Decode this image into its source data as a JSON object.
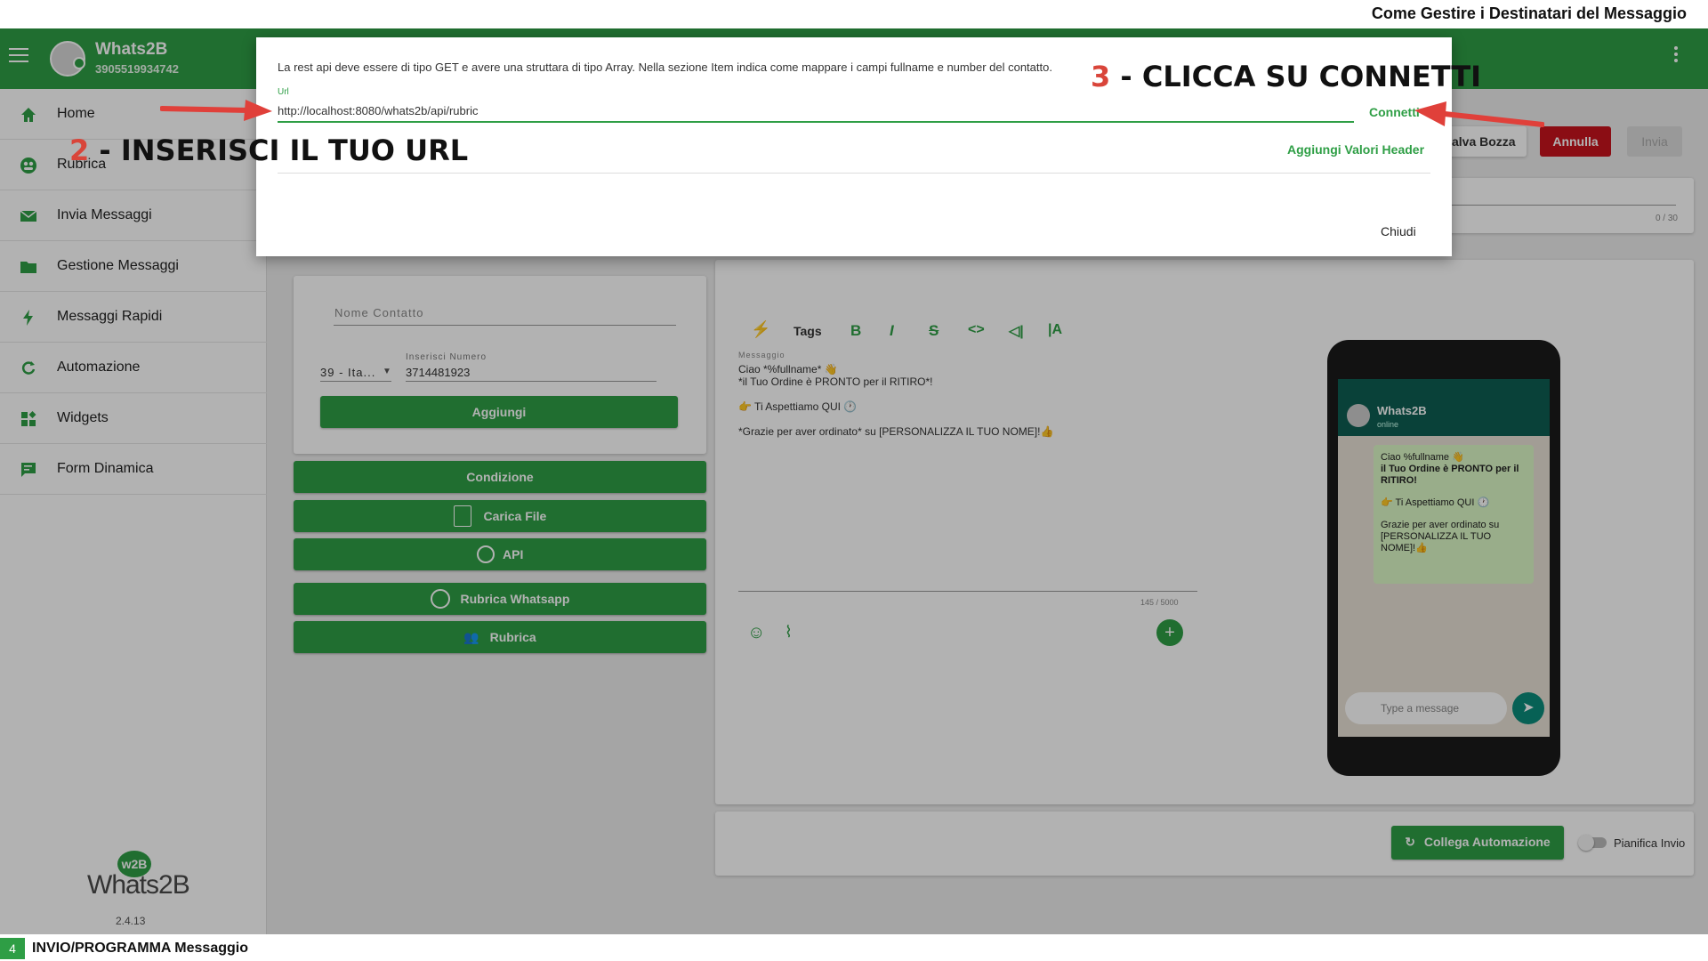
{
  "caption": {
    "top_title": "Come Gestire i Destinatari del Messaggio",
    "step_number": "4",
    "bottom_title": "INVIO/PROGRAMMA Messaggio"
  },
  "app": {
    "brand_name": "Whats2B",
    "brand_phone": "3905519934742",
    "version": "2.4.13",
    "logo_badge": "w2B",
    "logo_word": "Whats2B"
  },
  "sidebar": {
    "items": [
      {
        "label": "Home",
        "icon": "home-icon"
      },
      {
        "label": "Rubrica",
        "icon": "contacts-icon"
      },
      {
        "label": "Invia Messaggi",
        "icon": "mail-icon"
      },
      {
        "label": "Gestione Messaggi",
        "icon": "folder-icon"
      },
      {
        "label": "Messaggi Rapidi",
        "icon": "lightning-icon"
      },
      {
        "label": "Automazione",
        "icon": "refresh-icon"
      },
      {
        "label": "Widgets",
        "icon": "widgets-icon"
      },
      {
        "label": "Form Dinamica",
        "icon": "form-icon"
      }
    ]
  },
  "actions": {
    "save_draft": "alva Bozza",
    "cancel": "Annulla",
    "send": "Invia",
    "counter_top": "0 / 30"
  },
  "contact_form": {
    "name_placeholder": "Nome Contatto",
    "prefix": "39 - Ita...",
    "number_label": "Inserisci Numero",
    "number_value": "3714481923",
    "add_button": "Aggiungi"
  },
  "recipient_buttons": {
    "condition": "Condizione",
    "upload": "Carica File",
    "api": "API",
    "whatsapp_contacts": "Rubrica Whatsapp",
    "contacts": "Rubrica"
  },
  "editor": {
    "tags_label": "Tags",
    "message_label": "Messaggio",
    "lines": [
      "Ciao *%fullname* 👋",
      "*il Tuo Ordine è PRONTO per il RITIRO*!",
      "",
      "👉 Ti Aspettiamo QUI 🕐",
      "",
      "*Grazie per aver ordinato* su [PERSONALIZZA IL TUO NOME]!👍"
    ],
    "char_counter": "145 / 5000"
  },
  "phone_preview": {
    "contact_name": "Whats2B",
    "status": "online",
    "bubble_lines": [
      "Ciao %fullname 👋",
      "il Tuo Ordine è PRONTO per il RITIRO!",
      "👉 Ti Aspettiamo QUI 🕐",
      "Grazie per aver ordinato su [PERSONALIZZA IL TUO NOME]!👍"
    ],
    "input_placeholder": "Type a message"
  },
  "footer_actions": {
    "link_automation": "Collega Automazione",
    "schedule_label": "Pianifica Invio"
  },
  "modal": {
    "description": "La rest api deve essere di tipo GET e avere una struttara di tipo Array. Nella sezione Item indica come mappare i campi fullname e number del contatto.",
    "url_label": "Url",
    "url_value": "http://localhost:8080/whats2b/api/rubric",
    "connect": "Connetti",
    "add_header": "Aggiungi Valori Header",
    "close": "Chiudi"
  },
  "annotations": {
    "step2_num": "2",
    "step2_text": " - INSERISCI IL TUO URL",
    "step3_num": "3",
    "step3_text": " - CLICCA SU CONNETTI"
  },
  "colors": {
    "brand_green": "#2e9e45",
    "danger_red": "#c8141e",
    "annotation_red": "#d9453a",
    "phone_header": "#0d5e52"
  }
}
